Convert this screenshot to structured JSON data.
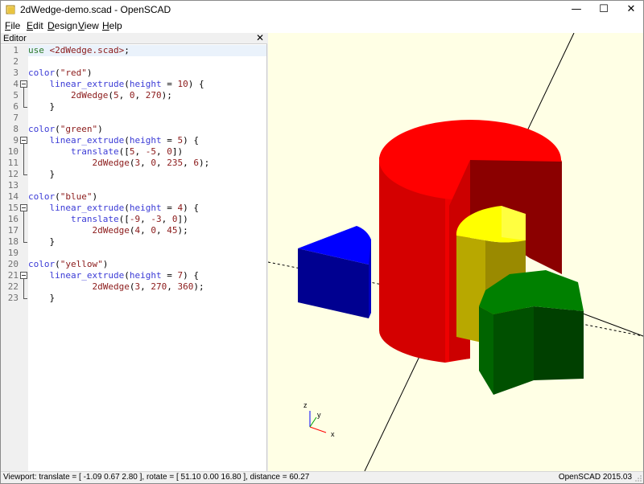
{
  "window": {
    "title": "2dWedge-demo.scad - OpenSCAD",
    "minimize": "—",
    "maximize": "☐",
    "close": "✕"
  },
  "menu": {
    "items": [
      {
        "label": "File",
        "key": "F",
        "rest": "ile"
      },
      {
        "label": "Edit",
        "key": "E",
        "rest": "dit"
      },
      {
        "label": "Design",
        "key": "D",
        "rest": "esign"
      },
      {
        "label": "View",
        "key": "V",
        "rest": "iew"
      },
      {
        "label": "Help",
        "key": "H",
        "rest": "elp"
      }
    ]
  },
  "editor": {
    "title": "Editor",
    "close": "✕",
    "lines": [
      {
        "n": "1",
        "html": "<span class='kw'>use</span> <span class='str'>&lt;2dWedge.scad&gt;</span>;"
      },
      {
        "n": "2",
        "html": ""
      },
      {
        "n": "3",
        "html": "<span class='fn'>color</span>(<span class='str'>\"red\"</span>)"
      },
      {
        "n": "4",
        "html": "    <span class='fn'>linear_extrude</span>(<span class='fn'>height</span> = <span class='num'>10</span>) {"
      },
      {
        "n": "5",
        "html": "        <span class='str'>2dWedge</span>(<span class='num'>5</span>, <span class='num'>0</span>, <span class='num'>270</span>);"
      },
      {
        "n": "6",
        "html": "    }"
      },
      {
        "n": "7",
        "html": ""
      },
      {
        "n": "8",
        "html": "<span class='fn'>color</span>(<span class='str'>\"green\"</span>)"
      },
      {
        "n": "9",
        "html": "    <span class='fn'>linear_extrude</span>(<span class='fn'>height</span> = <span class='num'>5</span>) {"
      },
      {
        "n": "10",
        "html": "        <span class='fn'>translate</span>([<span class='num'>5</span>, <span class='num'>-5</span>, <span class='num'>0</span>])"
      },
      {
        "n": "11",
        "html": "            <span class='str'>2dWedge</span>(<span class='num'>3</span>, <span class='num'>0</span>, <span class='num'>235</span>, <span class='num'>6</span>);"
      },
      {
        "n": "12",
        "html": "    }"
      },
      {
        "n": "13",
        "html": ""
      },
      {
        "n": "14",
        "html": "<span class='fn'>color</span>(<span class='str'>\"blue\"</span>)"
      },
      {
        "n": "15",
        "html": "    <span class='fn'>linear_extrude</span>(<span class='fn'>height</span> = <span class='num'>4</span>) {"
      },
      {
        "n": "16",
        "html": "        <span class='fn'>translate</span>([<span class='num'>-9</span>, <span class='num'>-3</span>, <span class='num'>0</span>])"
      },
      {
        "n": "17",
        "html": "            <span class='str'>2dWedge</span>(<span class='num'>4</span>, <span class='num'>0</span>, <span class='num'>45</span>);"
      },
      {
        "n": "18",
        "html": "    }"
      },
      {
        "n": "19",
        "html": ""
      },
      {
        "n": "20",
        "html": "<span class='fn'>color</span>(<span class='str'>\"yellow\"</span>)"
      },
      {
        "n": "21",
        "html": "    <span class='fn'>linear_extrude</span>(<span class='fn'>height</span> = <span class='num'>7</span>) {"
      },
      {
        "n": "22",
        "html": "            <span class='str'>2dWedge</span>(<span class='num'>3</span>, <span class='num'>270</span>, <span class='num'>360</span>);"
      },
      {
        "n": "23",
        "html": "    }"
      }
    ]
  },
  "viewport": {
    "background": "#ffffe5",
    "axis_labels": {
      "x": "x",
      "y": "y",
      "z": "z"
    },
    "objects": [
      {
        "name": "red-wedge",
        "color": "#ff0000"
      },
      {
        "name": "green-wedge",
        "color": "#008000"
      },
      {
        "name": "blue-wedge",
        "color": "#0000ff"
      },
      {
        "name": "yellow-wedge",
        "color": "#ffff00"
      }
    ]
  },
  "status": {
    "viewport_text": "Viewport: translate = [ -1.09 0.67 2.80 ], rotate = [ 51.10 0.00 16.80 ], distance = 60.27",
    "version": "OpenSCAD 2015.03"
  }
}
